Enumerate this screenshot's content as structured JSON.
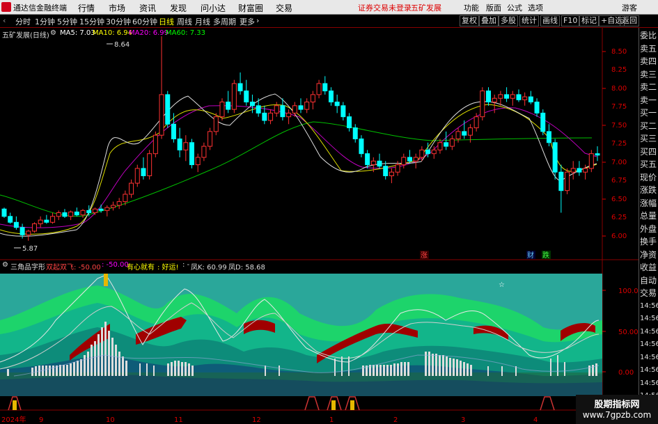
{
  "menubar": {
    "app_name": "通达信金融终端",
    "menus": [
      "行情",
      "市场",
      "资讯",
      "发现",
      "问小达",
      "财富圈",
      "交易"
    ],
    "warning": "证券交易未登录",
    "stock_name": "五矿发展",
    "right_menus": [
      "功能",
      "版面",
      "公式",
      "选项"
    ],
    "user": "游客"
  },
  "toolbar": {
    "timeframes": [
      "分时",
      "1分钟",
      "5分钟",
      "15分钟",
      "30分钟",
      "60分钟",
      "日线",
      "周线",
      "月线",
      "多周期",
      "更多"
    ],
    "active_timeframe": "日线",
    "tools": [
      "复权",
      "叠加",
      "多股",
      "统计",
      "画线",
      "F10",
      "标记",
      "+自选",
      "返回"
    ]
  },
  "price_info": {
    "title": "五矿发展(日线)",
    "ma5": "MA5: 7.03",
    "ma10": "MA10: 6.94",
    "ma20": "MA20: 6.99",
    "ma60": "MA60: 7.33",
    "colors": {
      "ma5": "#ffffff",
      "ma10": "#ffff00",
      "ma20": "#ff00ff",
      "ma60": "#00ff00"
    }
  },
  "price_axis": [
    "8.50",
    "8.25",
    "8.00",
    "7.75",
    "7.50",
    "7.25",
    "7.00",
    "6.75",
    "6.50",
    "6.25",
    "6.00"
  ],
  "annotations": {
    "high": "8.64",
    "low": "5.87"
  },
  "event_markers": [
    "涨",
    "财",
    "跌"
  ],
  "indicator_info": {
    "name": "三角品字形",
    "label1": "双起双飞: -50.00",
    "label2": ": -50.00",
    "label3": "有心就有",
    "label4": ": 好运!",
    "label5": ": -",
    "k_label": "凤K: 60.99",
    "d_label": "凤D: 58.68"
  },
  "indicator_axis": [
    "100.0",
    "50.00",
    "0.00"
  ],
  "right_panel": [
    "委比",
    "卖五",
    "卖四",
    "卖三",
    "卖二",
    "卖一",
    "买一",
    "买二",
    "买三",
    "买四",
    "买五",
    "现价",
    "涨跌",
    "涨幅",
    "总量",
    "外盘",
    "换手",
    "净资",
    "收益",
    "自动",
    "交易",
    "14:56",
    "14:56",
    "14:56",
    "14:56",
    "14:56",
    "14:56",
    "14:56",
    "14:56"
  ],
  "date_axis": [
    "2024年",
    "9",
    "10",
    "11",
    "12",
    "1",
    "2",
    "3",
    "4"
  ],
  "watermark": {
    "line1": "股期指标网",
    "line2": "www.7gpzb.com"
  },
  "chart_data": {
    "type": "candlestick",
    "ylim": [
      5.85,
      8.7
    ],
    "ohlc": [
      [
        6.3,
        6.32,
        6.18,
        6.2
      ],
      [
        6.2,
        6.25,
        6.1,
        6.12
      ],
      [
        6.12,
        6.2,
        6.02,
        6.05
      ],
      [
        6.05,
        6.1,
        5.9,
        5.95
      ],
      [
        5.95,
        6.02,
        5.87,
        6.0
      ],
      [
        6.0,
        6.12,
        5.98,
        6.1
      ],
      [
        6.1,
        6.2,
        6.05,
        6.15
      ],
      [
        6.15,
        6.22,
        6.1,
        6.12
      ],
      [
        6.12,
        6.25,
        6.1,
        6.2
      ],
      [
        6.2,
        6.28,
        6.15,
        6.25
      ],
      [
        6.25,
        6.3,
        6.18,
        6.2
      ],
      [
        6.2,
        6.28,
        6.15,
        6.26
      ],
      [
        6.26,
        6.32,
        6.2,
        6.22
      ],
      [
        6.22,
        6.3,
        6.18,
        6.28
      ],
      [
        6.28,
        6.35,
        6.2,
        6.25
      ],
      [
        6.25,
        6.32,
        6.22,
        6.3
      ],
      [
        6.3,
        6.36,
        6.25,
        6.28
      ],
      [
        6.28,
        6.35,
        6.2,
        6.32
      ],
      [
        6.32,
        6.4,
        6.28,
        6.35
      ],
      [
        6.35,
        6.45,
        6.3,
        6.4
      ],
      [
        6.4,
        6.55,
        6.35,
        6.5
      ],
      [
        6.5,
        6.7,
        6.45,
        6.65
      ],
      [
        6.65,
        6.9,
        6.6,
        6.85
      ],
      [
        6.85,
        7.0,
        6.7,
        6.75
      ],
      [
        6.75,
        7.1,
        6.7,
        7.05
      ],
      [
        7.05,
        7.35,
        7.0,
        7.3
      ],
      [
        7.3,
        8.64,
        7.25,
        7.85
      ],
      [
        7.85,
        7.9,
        7.4,
        7.45
      ],
      [
        7.45,
        7.6,
        7.2,
        7.25
      ],
      [
        7.25,
        7.4,
        7.0,
        7.1
      ],
      [
        7.1,
        7.3,
        6.95,
        7.2
      ],
      [
        7.2,
        7.25,
        6.85,
        6.9
      ],
      [
        6.9,
        7.05,
        6.8,
        7.0
      ],
      [
        7.0,
        7.2,
        6.95,
        7.15
      ],
      [
        7.15,
        7.4,
        7.1,
        7.35
      ],
      [
        7.35,
        7.6,
        7.3,
        7.55
      ],
      [
        7.55,
        7.8,
        7.5,
        7.75
      ],
      [
        7.75,
        7.9,
        7.6,
        7.65
      ],
      [
        7.65,
        8.05,
        7.6,
        8.0
      ],
      [
        8.0,
        8.15,
        7.85,
        7.9
      ],
      [
        7.9,
        8.05,
        7.7,
        7.75
      ],
      [
        7.75,
        7.85,
        7.6,
        7.7
      ],
      [
        7.7,
        7.8,
        7.55,
        7.6
      ],
      [
        7.6,
        7.7,
        7.45,
        7.5
      ],
      [
        7.5,
        7.65,
        7.45,
        7.6
      ],
      [
        7.6,
        7.75,
        7.55,
        7.7
      ],
      [
        7.7,
        7.8,
        7.5,
        7.55
      ],
      [
        7.55,
        7.65,
        7.45,
        7.6
      ],
      [
        7.6,
        7.75,
        7.55,
        7.7
      ],
      [
        7.7,
        7.8,
        7.6,
        7.65
      ],
      [
        7.65,
        7.8,
        7.6,
        7.75
      ],
      [
        7.75,
        7.9,
        7.65,
        7.85
      ],
      [
        7.85,
        8.05,
        7.8,
        8.0
      ],
      [
        8.0,
        8.1,
        7.85,
        7.9
      ],
      [
        7.9,
        7.95,
        7.7,
        7.75
      ],
      [
        7.75,
        7.85,
        7.6,
        7.7
      ],
      [
        7.7,
        7.75,
        7.5,
        7.55
      ],
      [
        7.55,
        7.6,
        7.35,
        7.4
      ],
      [
        7.4,
        7.45,
        7.2,
        7.25
      ],
      [
        7.25,
        7.3,
        7.0,
        7.05
      ],
      [
        7.05,
        7.1,
        6.85,
        6.9
      ],
      [
        6.9,
        7.0,
        6.8,
        6.95
      ],
      [
        6.95,
        7.05,
        6.85,
        6.88
      ],
      [
        6.88,
        6.95,
        6.7,
        6.75
      ],
      [
        6.75,
        6.85,
        6.65,
        6.8
      ],
      [
        6.8,
        6.95,
        6.75,
        6.9
      ],
      [
        6.9,
        7.05,
        6.85,
        7.0
      ],
      [
        7.0,
        7.1,
        6.92,
        6.95
      ],
      [
        6.95,
        7.05,
        6.85,
        7.0
      ],
      [
        7.0,
        7.15,
        6.95,
        7.1
      ],
      [
        7.1,
        7.2,
        7.0,
        7.05
      ],
      [
        7.05,
        7.15,
        6.98,
        7.1
      ],
      [
        7.1,
        7.25,
        7.05,
        7.2
      ],
      [
        7.2,
        7.35,
        7.1,
        7.15
      ],
      [
        7.15,
        7.3,
        7.1,
        7.25
      ],
      [
        7.25,
        7.4,
        7.2,
        7.35
      ],
      [
        7.35,
        7.5,
        7.25,
        7.3
      ],
      [
        7.3,
        7.45,
        7.2,
        7.4
      ],
      [
        7.4,
        7.6,
        7.35,
        7.55
      ],
      [
        7.55,
        7.95,
        7.5,
        7.9
      ],
      [
        7.9,
        7.95,
        7.7,
        7.75
      ],
      [
        7.75,
        7.85,
        7.6,
        7.8
      ],
      [
        7.8,
        7.9,
        7.7,
        7.85
      ],
      [
        7.85,
        7.95,
        7.75,
        7.8
      ],
      [
        7.8,
        7.9,
        7.7,
        7.85
      ],
      [
        7.85,
        7.92,
        7.75,
        7.78
      ],
      [
        7.78,
        7.88,
        7.7,
        7.82
      ],
      [
        7.82,
        7.9,
        7.72,
        7.75
      ],
      [
        7.75,
        7.8,
        7.55,
        7.6
      ],
      [
        7.6,
        7.65,
        7.3,
        7.35
      ],
      [
        7.35,
        7.45,
        7.15,
        7.2
      ],
      [
        7.2,
        7.25,
        6.7,
        6.8
      ],
      [
        6.8,
        6.9,
        6.25,
        6.55
      ],
      [
        6.55,
        6.85,
        6.5,
        6.8
      ],
      [
        6.8,
        6.95,
        6.7,
        6.85
      ],
      [
        6.85,
        6.95,
        6.75,
        6.8
      ],
      [
        6.8,
        6.9,
        6.7,
        6.85
      ],
      [
        6.85,
        7.1,
        6.8,
        7.05
      ],
      [
        7.05,
        7.15,
        6.95,
        7.03
      ]
    ]
  }
}
